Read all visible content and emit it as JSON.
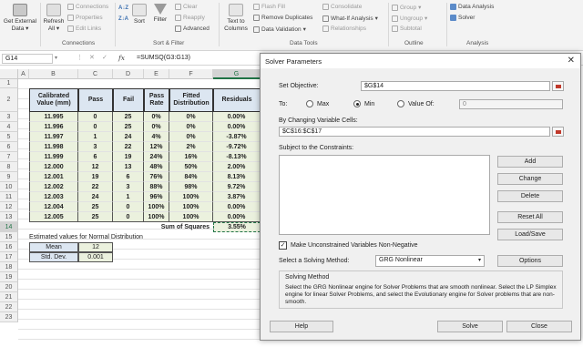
{
  "ribbon": {
    "get_external_data_label": "Get External",
    "get_external_data_label2": "Data",
    "refresh_all_label": "Refresh",
    "refresh_all_label2": "All",
    "connections_label": "Connections",
    "properties_label": "Properties",
    "edit_links_label": "Edit Links",
    "connections_group": "Connections",
    "sort_label": "Sort",
    "filter_label": "Filter",
    "clear_label": "Clear",
    "reapply_label": "Reapply",
    "advanced_label": "Advanced",
    "sort_filter_group": "Sort & Filter",
    "text_to_columns_label": "Text to",
    "text_to_columns_label2": "Columns",
    "flash_fill_label": "Flash Fill",
    "remove_duplicates_label": "Remove Duplicates",
    "data_validation_label": "Data Validation",
    "consolidate_label": "Consolidate",
    "what_if_label": "What-If Analysis",
    "relationships_label": "Relationships",
    "data_tools_group": "Data Tools",
    "group_label": "Group",
    "ungroup_label": "Ungroup",
    "subtotal_label": "Subtotal",
    "outline_group": "Outline",
    "data_analysis_label": "Data Analysis",
    "solver_label": "Solver",
    "analysis_group": "Analysis"
  },
  "formula_bar": {
    "name_box": "G14",
    "fx": "fx",
    "formula": "=SUMSQ(G3:G13)"
  },
  "columns": [
    "A",
    "B",
    "C",
    "D",
    "E",
    "F",
    "G"
  ],
  "rows": [
    "1",
    "2",
    "3",
    "4",
    "5",
    "6",
    "7",
    "8",
    "9",
    "10",
    "11",
    "12",
    "13",
    "14",
    "15",
    "16",
    "17",
    "18",
    "19",
    "20",
    "21",
    "22",
    "23"
  ],
  "table": {
    "headers": [
      "Calibrated Value (mm)",
      "Pass",
      "Fail",
      "Pass Rate",
      "Fitted Distribution",
      "Residuals"
    ],
    "data": [
      [
        "11.995",
        "0",
        "25",
        "0%",
        "0%",
        "0.00%"
      ],
      [
        "11.996",
        "0",
        "25",
        "0%",
        "0%",
        "0.00%"
      ],
      [
        "11.997",
        "1",
        "24",
        "4%",
        "0%",
        "-3.87%"
      ],
      [
        "11.998",
        "3",
        "22",
        "12%",
        "2%",
        "-9.72%"
      ],
      [
        "11.999",
        "6",
        "19",
        "24%",
        "16%",
        "-8.13%"
      ],
      [
        "12.000",
        "12",
        "13",
        "48%",
        "50%",
        "2.00%"
      ],
      [
        "12.001",
        "19",
        "6",
        "76%",
        "84%",
        "8.13%"
      ],
      [
        "12.002",
        "22",
        "3",
        "88%",
        "98%",
        "9.72%"
      ],
      [
        "12.003",
        "24",
        "1",
        "96%",
        "100%",
        "3.87%"
      ],
      [
        "12.004",
        "25",
        "0",
        "100%",
        "100%",
        "0.00%"
      ],
      [
        "12.005",
        "25",
        "0",
        "100%",
        "100%",
        "0.00%"
      ]
    ],
    "sum_label": "Sum of Squares",
    "sum_value": "3.55%",
    "estimated_label": "Estimated values for Normal Distribution",
    "mean_label": "Mean",
    "mean_value": "12",
    "stddev_label": "Std. Dev.",
    "stddev_value": "0.001"
  },
  "dialog": {
    "title": "Solver Parameters",
    "set_objective_label": "Set Objective:",
    "objective_value": "$G$14",
    "to_label": "To:",
    "max_label": "Max",
    "min_label": "Min",
    "value_of_label": "Value Of:",
    "value_of_value": "0",
    "changing_cells_label": "By Changing Variable Cells:",
    "changing_cells_value": "$C$16:$C$17",
    "constraints_label": "Subject to the Constraints:",
    "add_label": "Add",
    "change_label": "Change",
    "delete_label": "Delete",
    "reset_all_label": "Reset All",
    "load_save_label": "Load/Save",
    "nonneg_label": "Make Unconstrained Variables Non-Negative",
    "method_label": "Select a Solving Method:",
    "method_value": "GRG Nonlinear",
    "options_label": "Options",
    "solving_method_title": "Solving Method",
    "solving_method_text": "Select the GRG Nonlinear engine for Solver Problems that are smooth nonlinear. Select the LP Simplex engine for linear Solver Problems, and select the Evolutionary engine for Solver problems that are non-smooth.",
    "help_label": "Help",
    "solve_label": "Solve",
    "close_label": "Close"
  }
}
